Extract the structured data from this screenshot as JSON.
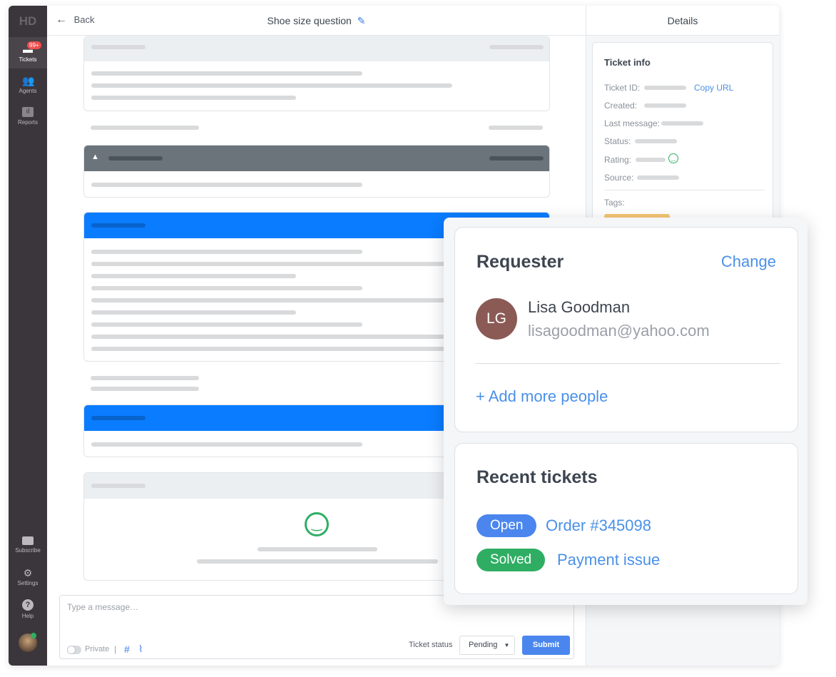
{
  "app": {
    "logo": "HD"
  },
  "sidebar": {
    "items": [
      {
        "label": "Tickets",
        "icon": "ticket-icon",
        "badge": "99+"
      },
      {
        "label": "Agents",
        "icon": "users-icon"
      },
      {
        "label": "Reports",
        "icon": "chart-icon"
      }
    ],
    "bottom": [
      {
        "label": "Subscribe",
        "icon": "card-icon"
      },
      {
        "label": "Settings",
        "icon": "gear-icon"
      },
      {
        "label": "Help",
        "icon": "help-icon"
      }
    ]
  },
  "header": {
    "back": "Back",
    "title": "Shoe size question"
  },
  "details": {
    "title": "Details",
    "ticket_info": "Ticket info",
    "fields": [
      "Ticket ID:",
      "Created:",
      "Last message:",
      "Status:",
      "Rating:",
      "Source:"
    ],
    "copy_url": "Copy URL",
    "tags": "Tags:"
  },
  "composer": {
    "placeholder": "Type a message…",
    "private": "Private",
    "separator": "|",
    "hash": "#",
    "ticket_status_label": "Ticket status",
    "status_value": "Pending",
    "submit": "Submit"
  },
  "requester": {
    "title": "Requester",
    "change": "Change",
    "initials": "LG",
    "name": "Lisa Goodman",
    "email": "lisagoodman@yahoo.com",
    "add_more": "+ Add more people"
  },
  "recent": {
    "title": "Recent tickets",
    "items": [
      {
        "status": "Open",
        "label": "Order #345098",
        "color": "#4a86ee"
      },
      {
        "status": "Solved",
        "label": "Payment issue",
        "color": "#2fae63"
      }
    ]
  },
  "colors": {
    "accent": "#4a86ee",
    "blue_header": "#0a7cff",
    "dark_header": "#6b737b",
    "success": "#2fae63",
    "sidebar": "#3b363b"
  }
}
